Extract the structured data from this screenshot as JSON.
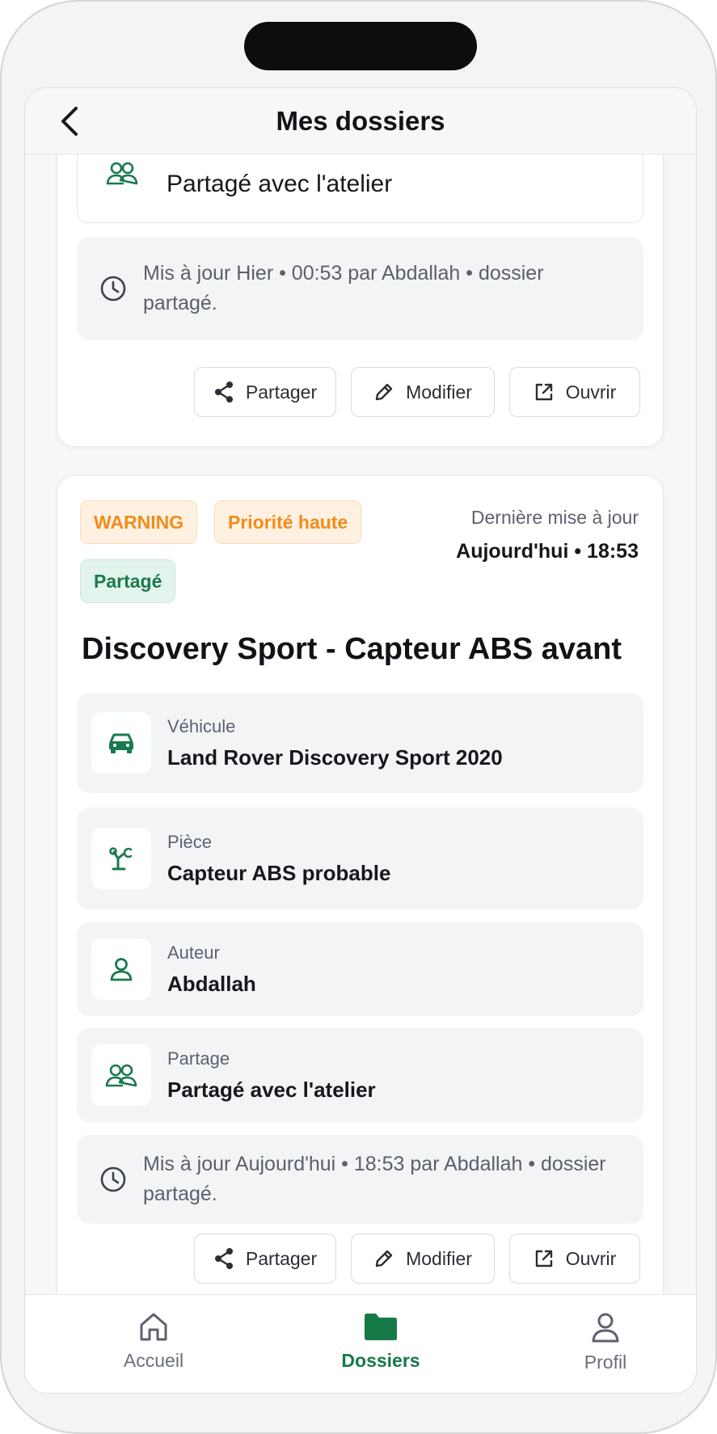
{
  "header": {
    "title": "Mes dossiers"
  },
  "card1": {
    "sharing_value": "Partagé avec l'atelier",
    "update_text": "Mis à jour Hier • 00:53 par Abdallah • dossier partagé.",
    "actions": {
      "share": "Partager",
      "edit": "Modifier",
      "open": "Ouvrir"
    }
  },
  "card2": {
    "badges": {
      "severity": "WARNING",
      "priority": "Priorité haute",
      "shared": "Partagé"
    },
    "last_update_label": "Dernière mise à jour",
    "last_update_value": "Aujourd'hui • 18:53",
    "title": "Discovery Sport - Capteur ABS avant",
    "details": [
      {
        "label": "Véhicule",
        "value": "Land Rover Discovery Sport 2020",
        "icon": "car-icon"
      },
      {
        "label": "Pièce",
        "value": "Capteur ABS probable",
        "icon": "part-icon"
      },
      {
        "label": "Auteur",
        "value": "Abdallah",
        "icon": "user-icon"
      },
      {
        "label": "Partage",
        "value": "Partagé avec l'atelier",
        "icon": "users-icon"
      }
    ],
    "update_text": "Mis à jour Aujourd'hui • 18:53 par Abdallah • dossier partagé.",
    "actions": {
      "share": "Partager",
      "edit": "Modifier",
      "open": "Ouvrir"
    }
  },
  "nav": {
    "items": [
      {
        "label": "Accueil",
        "icon": "home-icon"
      },
      {
        "label": "Dossiers",
        "icon": "folder-icon",
        "active": true
      },
      {
        "label": "Profil",
        "icon": "profile-icon"
      }
    ]
  },
  "colors": {
    "accent_green": "#167a48",
    "warning_orange": "#f28c1b"
  }
}
